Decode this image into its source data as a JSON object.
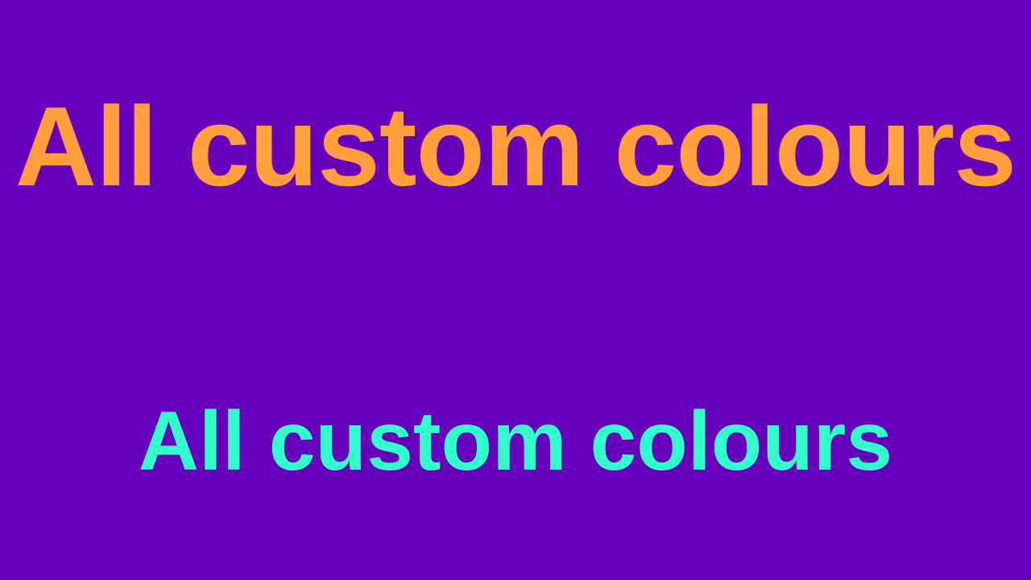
{
  "slide": {
    "title": "All custom colours",
    "subtitle": "All custom colours"
  },
  "colors": {
    "background": "#6600bb",
    "title": "#ff9e3d",
    "subtitle": "#33ffcc"
  }
}
